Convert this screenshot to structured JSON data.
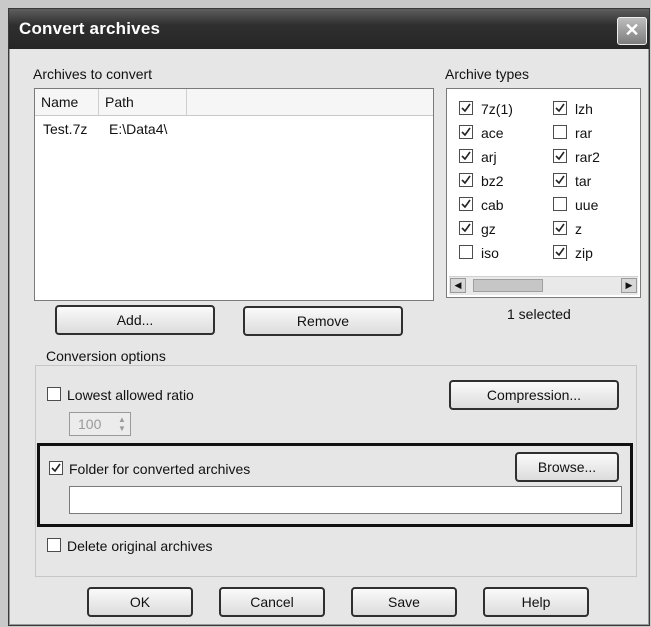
{
  "window": {
    "title": "Convert archives",
    "close_glyph": "✕"
  },
  "archives": {
    "group_label": "Archives to convert",
    "columns": [
      "Name",
      "Path"
    ],
    "rows": [
      {
        "name": "Test.7z",
        "path": "E:\\Data4\\"
      }
    ]
  },
  "types": {
    "group_label": "Archive types",
    "left": [
      {
        "label": "7z(1)",
        "checked": true
      },
      {
        "label": "ace",
        "checked": true
      },
      {
        "label": "arj",
        "checked": true
      },
      {
        "label": "bz2",
        "checked": true
      },
      {
        "label": "cab",
        "checked": true
      },
      {
        "label": "gz",
        "checked": true
      },
      {
        "label": "iso",
        "checked": false
      }
    ],
    "right": [
      {
        "label": "lzh",
        "checked": true
      },
      {
        "label": "rar",
        "checked": false
      },
      {
        "label": "rar2",
        "checked": true
      },
      {
        "label": "tar",
        "checked": true
      },
      {
        "label": "uue",
        "checked": false
      },
      {
        "label": "z",
        "checked": true
      },
      {
        "label": "zip",
        "checked": true
      }
    ],
    "selected_status": "1 selected"
  },
  "buttons": {
    "add": "Add...",
    "remove": "Remove",
    "compression": "Compression...",
    "browse": "Browse...",
    "ok": "OK",
    "cancel": "Cancel",
    "save": "Save",
    "help": "Help"
  },
  "options": {
    "group_label": "Conversion options",
    "lowest_ratio": {
      "label": "Lowest allowed ratio",
      "checked": false,
      "value": "100"
    },
    "folder": {
      "label": "Folder for converted archives",
      "checked": true,
      "value": ""
    },
    "delete_original": {
      "label": "Delete original archives",
      "checked": false
    }
  },
  "icons": {
    "scroll_left": "scroll-left-arrow-icon",
    "scroll_right": "scroll-right-arrow-icon"
  }
}
